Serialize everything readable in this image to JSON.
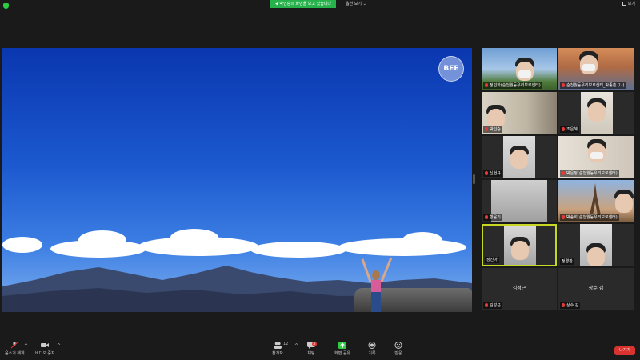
{
  "top": {
    "share_banner": "◀ 박인승의 화면을 보고 있습니다",
    "view_options": "옵션 보기 ⌄",
    "view_toggle": "보기"
  },
  "share": {
    "logo_text": "BEE"
  },
  "participants": [
    {
      "name": "정민화(순천월등우리보로센터)",
      "muted": true
    },
    {
      "name": "순천월등우리보로센터_박종훈 (나)",
      "muted": true
    },
    {
      "name": "박인승",
      "muted": true
    },
    {
      "name": "조은혜",
      "muted": true
    },
    {
      "name": "신현규",
      "muted": true
    },
    {
      "name": "박은정(순천월등우리보로센터)",
      "muted": true
    },
    {
      "name": "황윤기",
      "muted": true
    },
    {
      "name": "박송희(순천월등우리보로센터)",
      "muted": true
    },
    {
      "name": "장진아",
      "muted": false,
      "active": true
    },
    {
      "name": "정경환",
      "muted": false
    },
    {
      "name": "김성근",
      "muted": true,
      "display": "김성근"
    },
    {
      "name": "상수 김",
      "muted": true,
      "display": "상수 김"
    }
  ],
  "toolbar": {
    "audio_label": "음소거 해제",
    "video_label": "비디오 중지",
    "participants_label": "참가자",
    "participants_count": "12",
    "chat_label": "채팅",
    "chat_badge": "3",
    "share_label": "화면 공유",
    "record_label": "기록",
    "reactions_label": "반응",
    "leave_label": "나가기"
  },
  "colors": {
    "share_banner": "#27b14a",
    "leave": "#d9332f",
    "active_border": "#c8d624"
  }
}
